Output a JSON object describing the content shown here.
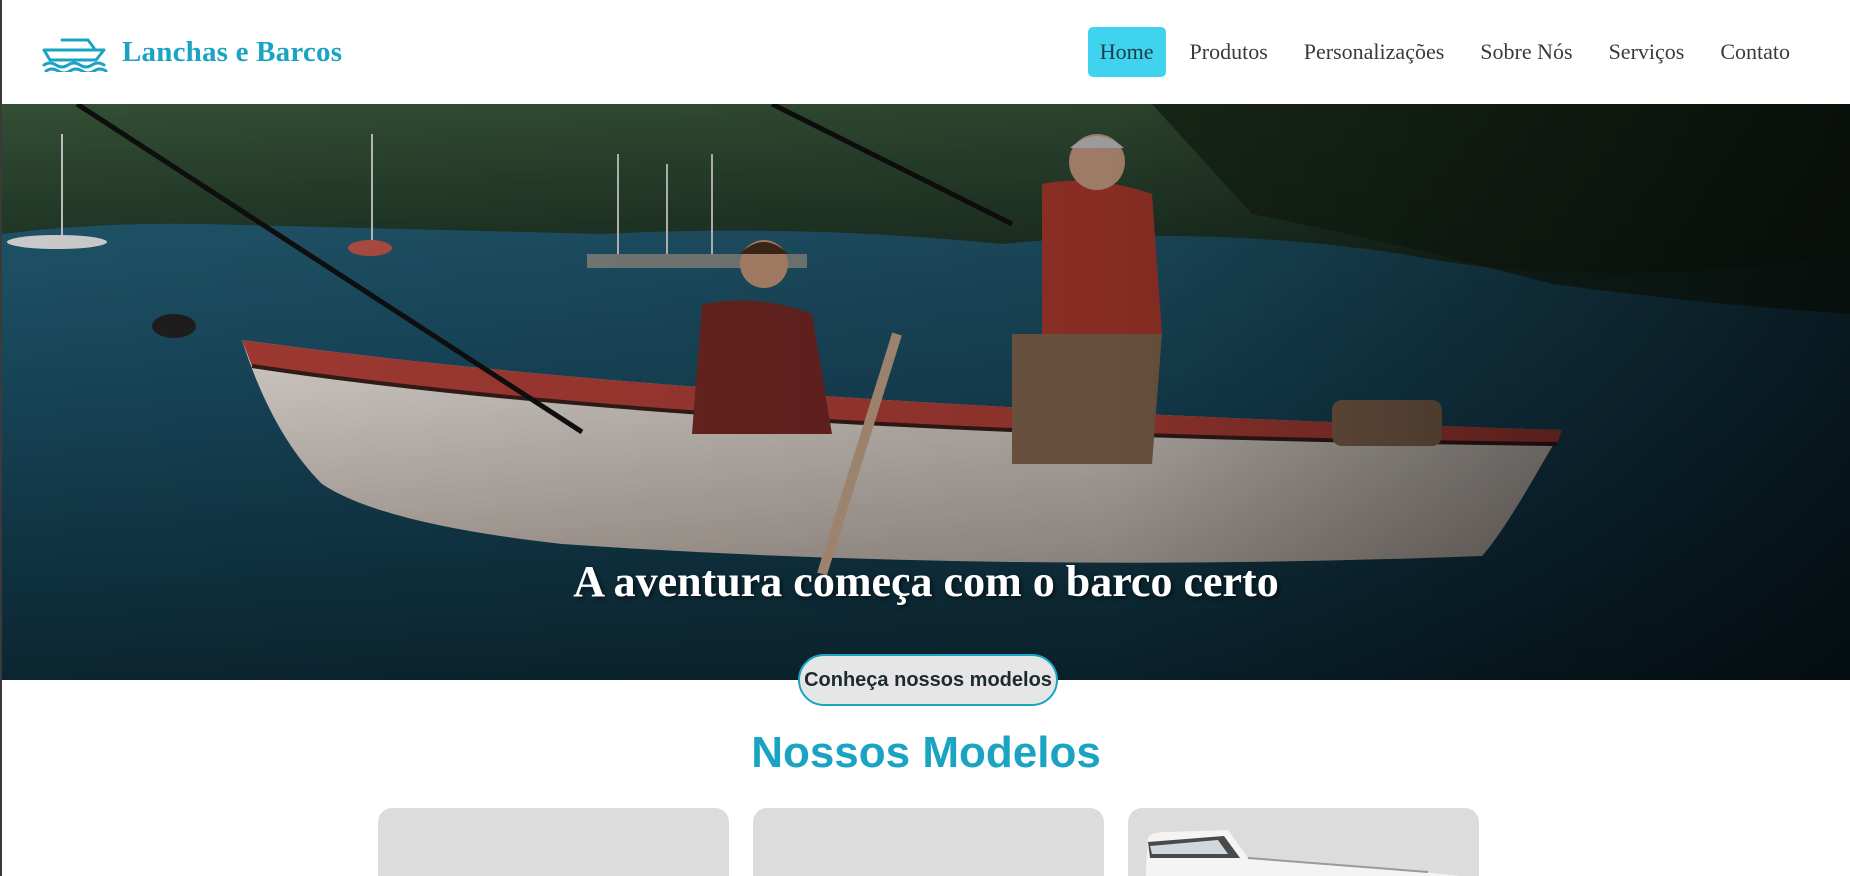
{
  "brand": {
    "name": "Lanchas e Barcos",
    "icon": "boat-icon",
    "color": "#1aa3c2"
  },
  "nav": {
    "items": [
      {
        "label": "Home",
        "active": true
      },
      {
        "label": "Produtos",
        "active": false
      },
      {
        "label": "Personalizações",
        "active": false
      },
      {
        "label": "Sobre Nós",
        "active": false
      },
      {
        "label": "Serviços",
        "active": false
      },
      {
        "label": "Contato",
        "active": false
      }
    ],
    "active_color": "#3fd3f0"
  },
  "hero": {
    "title": "A aventura começa com o barco certo",
    "cta_label": "Conheça nossos modelos"
  },
  "models": {
    "title": "Nossos Modelos",
    "cards": [
      {
        "image": "empty"
      },
      {
        "image": "empty"
      },
      {
        "image": "white-speedboat"
      }
    ]
  }
}
